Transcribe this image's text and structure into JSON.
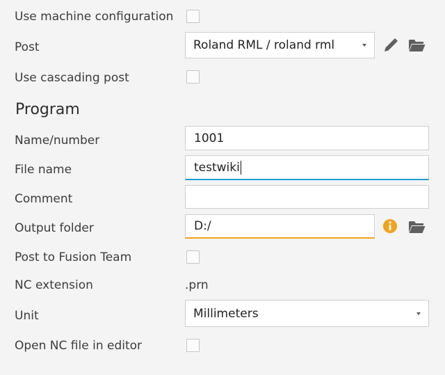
{
  "rows": {
    "use_machine_config": {
      "label": "Use machine configuration"
    },
    "post": {
      "label": "Post",
      "value": "Roland RML / roland rml"
    },
    "use_cascading_post": {
      "label": "Use cascading post"
    }
  },
  "program": {
    "title": "Program",
    "name_number": {
      "label": "Name/number",
      "value": "1001"
    },
    "file_name": {
      "label": "File name",
      "value": "testwiki"
    },
    "comment": {
      "label": "Comment",
      "value": ""
    },
    "output_folder": {
      "label": "Output folder",
      "value": "D:/"
    },
    "post_to_fusion_team": {
      "label": "Post to Fusion Team"
    },
    "nc_extension": {
      "label": "NC extension",
      "value": ".prn"
    },
    "unit": {
      "label": "Unit",
      "value": "Millimeters"
    },
    "open_nc_in_editor": {
      "label": "Open NC file in editor"
    }
  },
  "icons": {
    "edit": "pencil-icon",
    "folder": "folder-open-icon",
    "info": "info-icon"
  },
  "colors": {
    "focus": "#1f9bd8",
    "warning": "#f0a31f"
  }
}
